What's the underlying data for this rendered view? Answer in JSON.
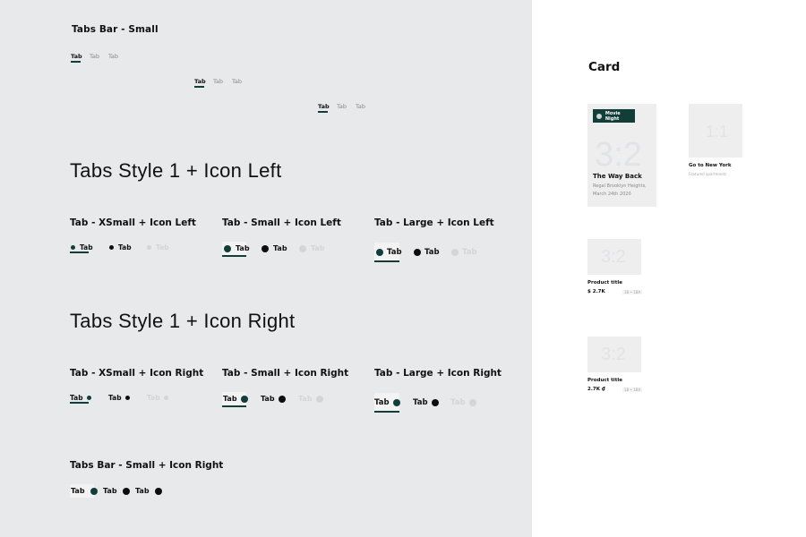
{
  "tabs_bar_small": {
    "title": "Tabs Bar - Small",
    "rows": [
      {
        "tabs": [
          "Tab",
          "Tab",
          "Tab"
        ]
      },
      {
        "tabs": [
          "Tab",
          "Tab",
          "Tab"
        ]
      },
      {
        "tabs": [
          "Tab",
          "Tab",
          "Tab"
        ]
      }
    ]
  },
  "style_icon_left": {
    "title": "Tabs Style 1 + Icon Left",
    "variants": [
      {
        "title": "Tab - XSmall + Icon Left",
        "tabs": [
          "Tab",
          "Tab",
          "Tab"
        ]
      },
      {
        "title": "Tab - Small + Icon Left",
        "tabs": [
          "Tab",
          "Tab",
          "Tab"
        ]
      },
      {
        "title": "Tab - Large + Icon Left",
        "tabs": [
          "Tab",
          "Tab",
          "Tab"
        ]
      }
    ]
  },
  "style_icon_right": {
    "title": "Tabs Style 1 + Icon Right",
    "variants": [
      {
        "title": "Tab - XSmall + Icon Right",
        "tabs": [
          "Tab",
          "Tab",
          "Tab"
        ]
      },
      {
        "title": "Tab - Small + Icon Right",
        "tabs": [
          "Tab",
          "Tab",
          "Tab"
        ]
      },
      {
        "title": "Tab - Large + Icon Right",
        "tabs": [
          "Tab",
          "Tab",
          "Tab"
        ]
      }
    ]
  },
  "tabs_bar_icon_right": {
    "title": "Tabs Bar - Small + Icon Right",
    "tabs": [
      "Tab",
      "Tab",
      "Tab"
    ]
  },
  "card_section": {
    "title": "Card",
    "event_card": {
      "badge": "Movie Night",
      "ratio": "3:2",
      "title": "The Way Back",
      "desc_line1": "Regal Brooklyn Heights,",
      "desc_line2": "March 24th 2020"
    },
    "small_card": {
      "ratio": "1:1",
      "title": "Go to New York",
      "subtitle": "Featured apartments"
    },
    "products": [
      {
        "ratio": "3:2",
        "title": "Product title",
        "price": "$ 2.7K",
        "sizes": "1B • 1BA"
      },
      {
        "ratio": "3:2",
        "title": "Product title",
        "price": "2.7K ₫",
        "sizes": "1B • 1BA"
      }
    ]
  },
  "colors": {
    "accent": "#123e3a",
    "canvas": "#e8e9eb",
    "panel": "#ffffff",
    "disabled": "#d4d5d8"
  }
}
